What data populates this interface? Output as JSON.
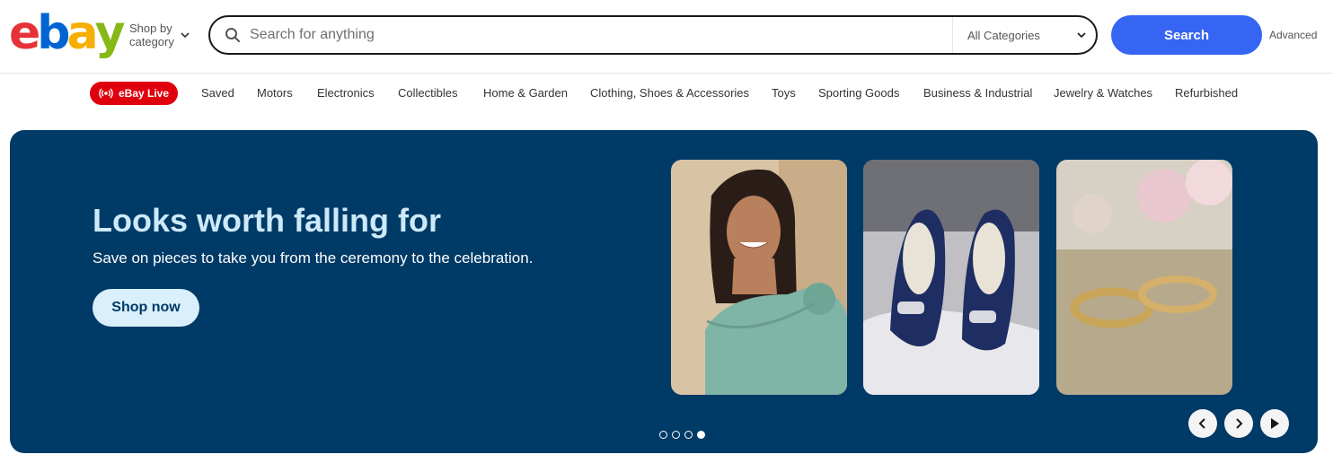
{
  "header": {
    "logo_letters": [
      "e",
      "b",
      "a",
      "y"
    ],
    "logo_colors": [
      "#e53238",
      "#0064d2",
      "#f5af02",
      "#86b817"
    ],
    "shop_by_line1": "Shop by",
    "shop_by_line2": "category",
    "search_placeholder": "Search for anything",
    "category_selected": "All Categories",
    "search_button": "Search",
    "advanced_link": "Advanced"
  },
  "nav": {
    "live_label": "eBay Live",
    "items": [
      "Saved",
      "Motors",
      "Electronics",
      "Collectibles",
      "Home & Garden",
      "Clothing, Shoes & Accessories",
      "Toys",
      "Sporting Goods",
      "Business & Industrial",
      "Jewelry & Watches",
      "Refurbished"
    ]
  },
  "hero": {
    "title": "Looks worth falling for",
    "subtitle": "Save on pieces to take you from the ceremony to the celebration.",
    "cta": "Shop now",
    "tiles": [
      "woman-in-teal-dress",
      "navy-heels",
      "gold-rings"
    ],
    "slide_count": 4,
    "active_slide": 4,
    "background_color": "#003a66"
  }
}
